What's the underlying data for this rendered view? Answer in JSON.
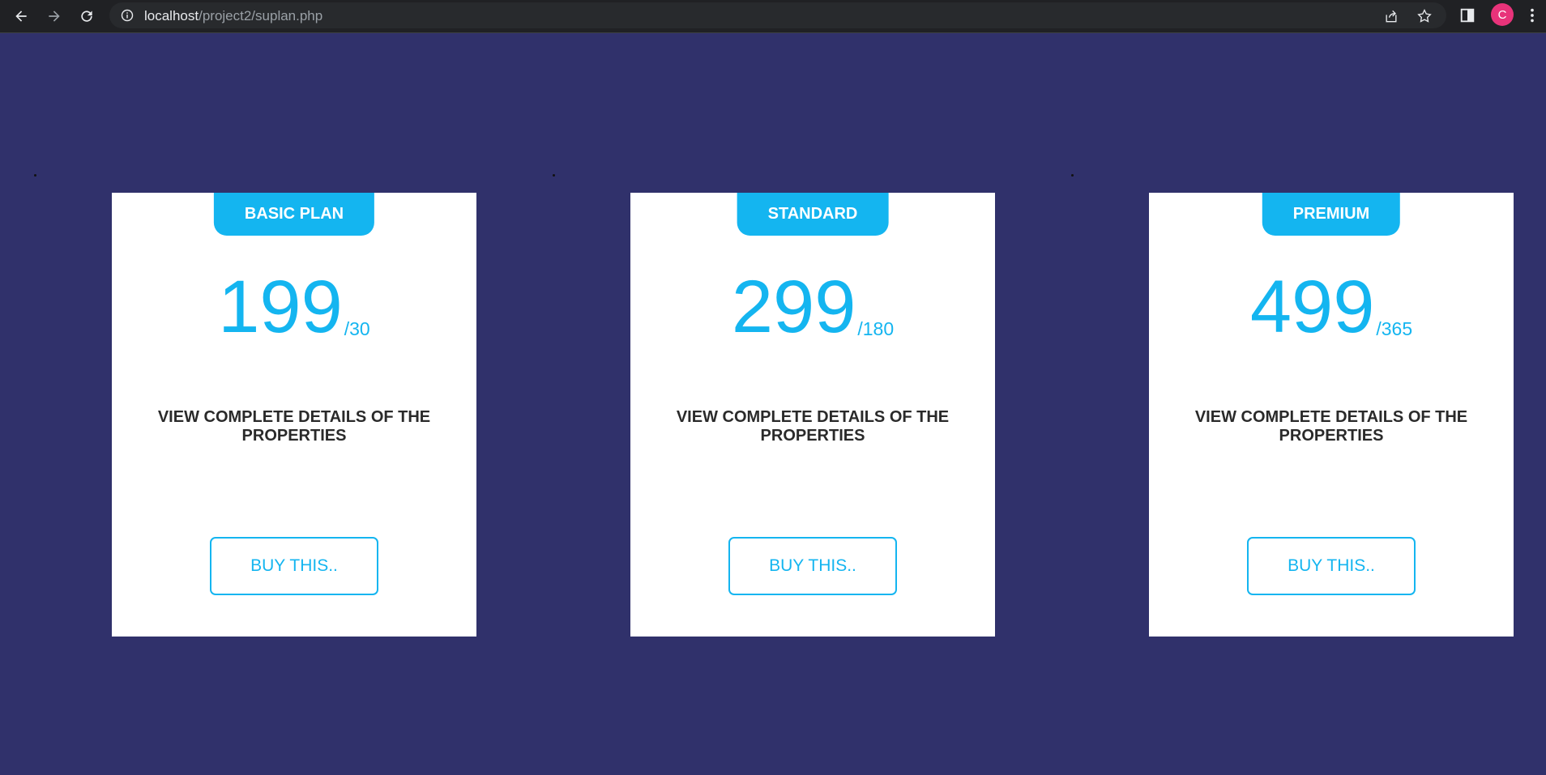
{
  "browser": {
    "url_host": "localhost",
    "url_path": "/project2/suplan.php",
    "avatar_letter": "C",
    "icons": [
      "back-icon",
      "forward-icon",
      "reload-icon",
      "info-icon",
      "share-icon",
      "star-icon",
      "side-panel-icon",
      "menu-icon"
    ]
  },
  "colors": {
    "background": "#30316b",
    "accent": "#14b5f0",
    "card": "#ffffff",
    "text": "#2a2a2a"
  },
  "plans": [
    {
      "name": "BASIC PLAN",
      "price": "199",
      "period": "/30",
      "description": "VIEW COMPLETE DETAILS OF THE PROPERTIES",
      "button": "BUY THIS.."
    },
    {
      "name": "STANDARD",
      "price": "299",
      "period": "/180",
      "description": "VIEW COMPLETE DETAILS OF THE PROPERTIES",
      "button": "BUY THIS.."
    },
    {
      "name": "PREMIUM",
      "price": "499",
      "period": "/365",
      "description": "VIEW COMPLETE DETAILS OF THE PROPERTIES",
      "button": "BUY THIS.."
    }
  ]
}
